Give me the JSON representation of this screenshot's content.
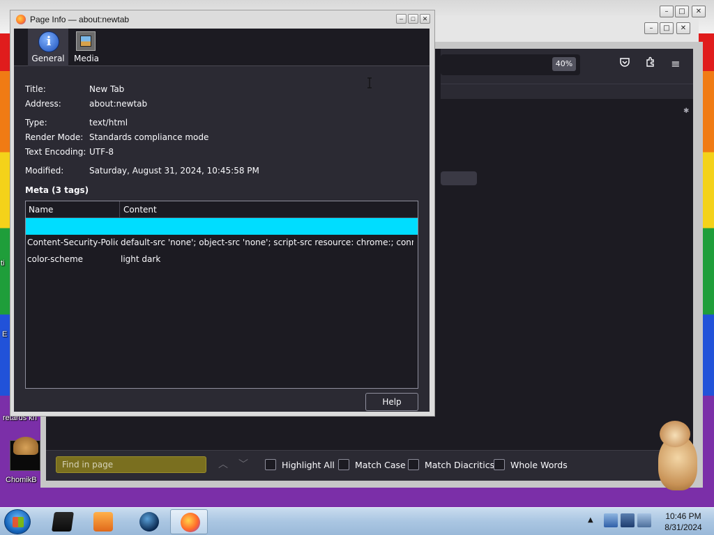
{
  "dialog": {
    "title": "Page Info — about:newtab",
    "tabs": [
      {
        "label": "General",
        "icon": "info-icon",
        "selected": true
      },
      {
        "label": "Media",
        "icon": "media-icon",
        "selected": false
      }
    ],
    "fields": {
      "title_key": "Title:",
      "title_val": "New Tab",
      "address_key": "Address:",
      "address_val": "about:newtab",
      "type_key": "Type:",
      "type_val": "text/html",
      "render_key": "Render Mode:",
      "render_val": "Standards compliance mode",
      "encoding_key": "Text Encoding:",
      "encoding_val": "UTF-8",
      "modified_key": "Modified:",
      "modified_val": "Saturday, August 31, 2024, 10:45:58 PM"
    },
    "meta": {
      "heading": "Meta (3 tags)",
      "columns": [
        "Name",
        "Content"
      ],
      "rows": [
        {
          "name": "",
          "content": "",
          "selected": true
        },
        {
          "name": "Content-Security-Polic...",
          "content": "default-src 'none'; object-src 'none'; script-src resource: chrome:; connect-src ..."
        },
        {
          "name": "color-scheme",
          "content": "light dark"
        }
      ]
    },
    "help_label": "Help"
  },
  "browser": {
    "zoom": "40%",
    "findbar": {
      "placeholder": "Find in page",
      "options": [
        "Highlight All",
        "Match Case",
        "Match Diacritics",
        "Whole Words"
      ]
    }
  },
  "desktop": {
    "labels": [
      "retards kn",
      "ChomikB"
    ],
    "side_letters": [
      "ti",
      "E"
    ]
  },
  "taskbar": {
    "time": "10:46 PM",
    "date": "8/31/2024"
  },
  "colors": {
    "dialog_bg": "#2b2a33",
    "selection": "#00ddff",
    "findbar_input": "#7a6f1f"
  }
}
